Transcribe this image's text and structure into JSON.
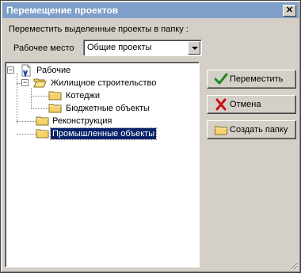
{
  "window": {
    "title": "Перемещение проектов"
  },
  "prompt": "Переместить выделенные проекты в папку :",
  "workspace": {
    "label": "Рабочее место",
    "value": "Общие проекты"
  },
  "tree": {
    "root": "Рабочие",
    "housing": "Жилищное строительство",
    "cottages": "Котеджи",
    "budget": "Бюджетные объекты",
    "reconstruction": "Реконструкция",
    "industrial": "Промышленные объекты"
  },
  "buttons": {
    "move": "Переместить",
    "cancel": "Отмена",
    "create_folder": "Создать папку"
  },
  "icons": {
    "close": "close-icon",
    "combo_arrow": "chevron-down-icon",
    "move": "checkmark-icon",
    "cancel": "x-mark-icon",
    "create_folder": "folder-icon",
    "root": "document-icon"
  },
  "colors": {
    "selection": "#0a246a",
    "titlebar": "#7e9fc9",
    "check": "#1e8c1e",
    "cross": "#c81414",
    "folder": "#f5d26a"
  }
}
